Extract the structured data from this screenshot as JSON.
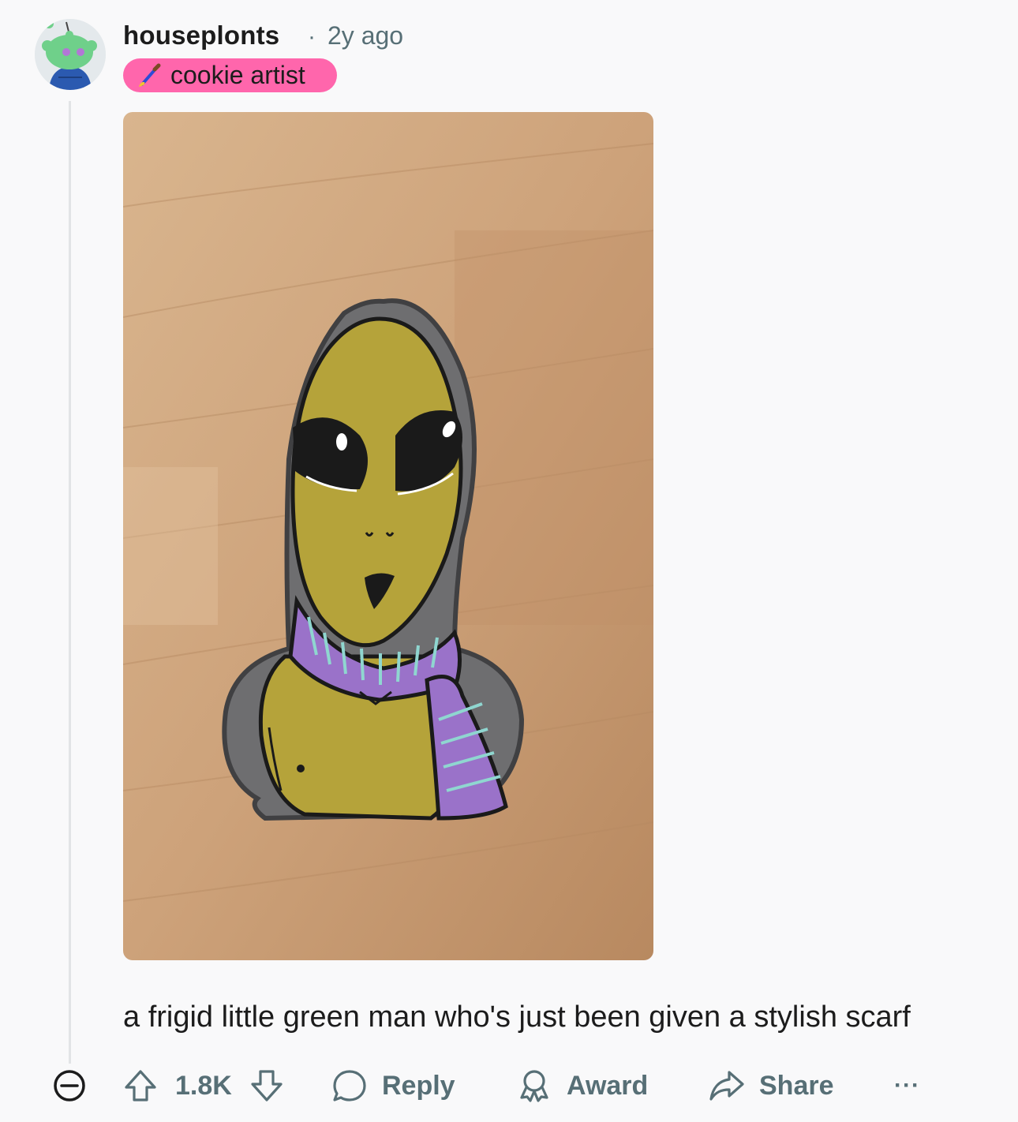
{
  "comment": {
    "username": "houseplonts",
    "separator": "·",
    "timestamp": "2y ago",
    "flair": {
      "icon": "paintbrush-icon",
      "text": "cookie artist",
      "background": "#ff66ac"
    },
    "image": {
      "subject": "alien-pin-with-scarf"
    },
    "body": "a frigid little green man who's just been given a stylish scarf"
  },
  "actions": {
    "vote_count": "1.8K",
    "reply_label": "Reply",
    "award_label": "Award",
    "share_label": "Share",
    "more_label": "···"
  },
  "colors": {
    "background": "#f9f9fa",
    "text_primary": "#1c1c1c",
    "text_secondary": "#576f76",
    "thread_line": "#e2e4e6"
  }
}
